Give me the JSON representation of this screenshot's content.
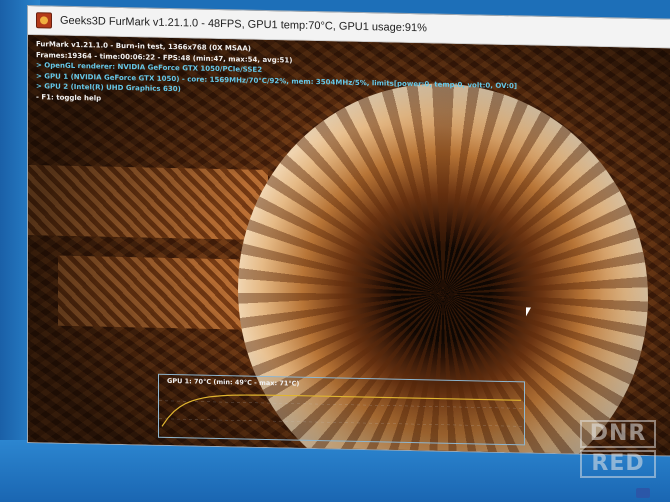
{
  "window": {
    "title": "Geeks3D FurMark v1.21.1.0 - 48FPS, GPU1 temp:70°C, GPU1 usage:91%",
    "icon": "furmark-app-icon"
  },
  "overlay": {
    "lines": [
      "FurMark v1.21.1.0 - Burn-in test, 1366x768 (0X MSAA)",
      "Frames:19364 - time:00:06:22 - FPS:48 (min:47, max:54, avg:51)",
      "> OpenGL renderer: NVIDIA GeForce GTX 1050/PCIe/SSE2",
      "> GPU 1 (NVIDIA GeForce GTX 1050) - core: 1569MHz/70°C/92%, mem: 3504MHz/5%, limits[power:0, temp:0, volt:0, OV:0]",
      "> GPU 2 (Intel(R) UHD Graphics 630)",
      "- F1: toggle help"
    ]
  },
  "graph": {
    "label": "GPU 1: 70°C (min: 49°C - max: 71°C)",
    "temperature_c": 70,
    "min_c": 49,
    "max_c": 71
  },
  "watermark": {
    "line1": "DNR",
    "line2": "RED"
  },
  "colors": {
    "overlay_text": "#f2f2f2",
    "overlay_highlight": "#66c8e8",
    "graph_line": "#e0b530",
    "graph_border": "#8fb6cf"
  }
}
